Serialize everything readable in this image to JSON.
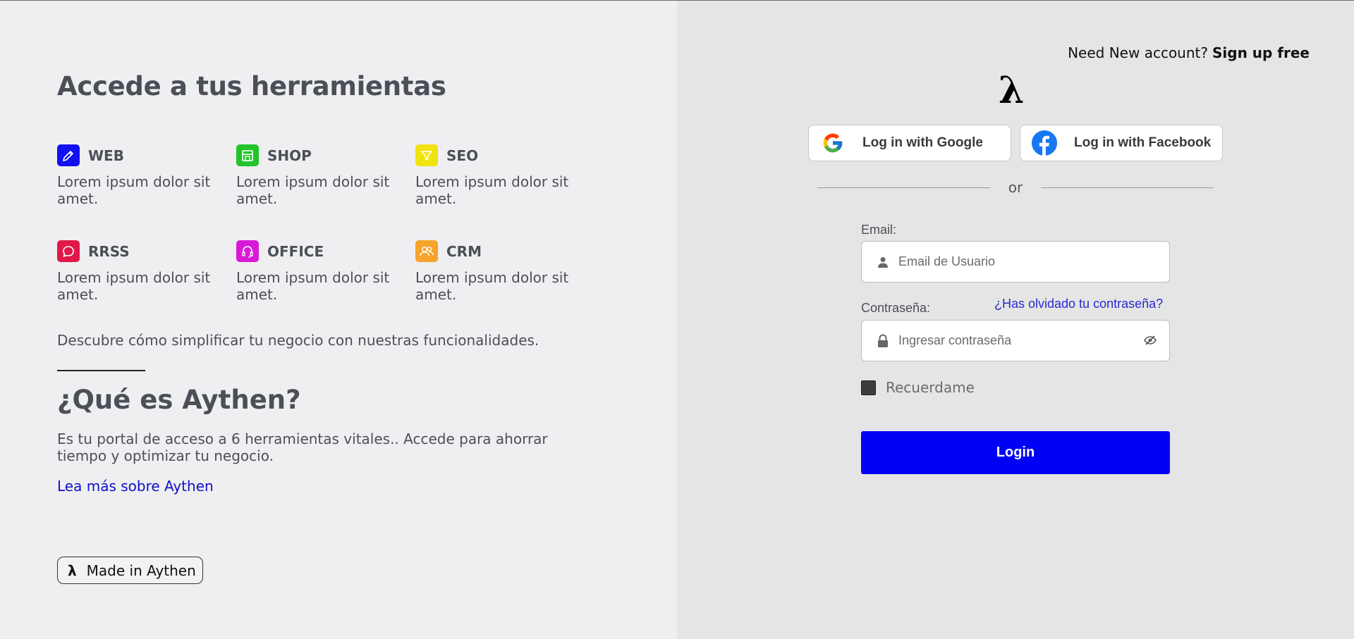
{
  "left": {
    "heading": "Accede a tus herramientas",
    "tools": [
      {
        "name": "WEB",
        "desc": "Lorem ipsum dolor sit amet.",
        "color": "#1010f0",
        "icon": "pencil-icon"
      },
      {
        "name": "SHOP",
        "desc": "Lorem ipsum dolor sit amet.",
        "color": "#22c42a",
        "icon": "store-icon"
      },
      {
        "name": "SEO",
        "desc": "Lorem ipsum dolor sit amet.",
        "color": "#f2e20f",
        "icon": "filter-icon"
      },
      {
        "name": "RRSS",
        "desc": "Lorem ipsum dolor sit amet.",
        "color": "#e0184a",
        "icon": "chat-bubble-icon"
      },
      {
        "name": "OFFICE",
        "desc": "Lorem ipsum dolor sit amet.",
        "color": "#d81ad8",
        "icon": "headset-icon"
      },
      {
        "name": "CRM",
        "desc": "Lorem ipsum dolor sit amet.",
        "color": "#f5a32a",
        "icon": "users-icon"
      }
    ],
    "discover": "Descubre cómo simplificar tu negocio con nuestras funcionalidades.",
    "what_title": "¿Qué es Aythen?",
    "what_desc": "Es tu portal de acceso a 6 herramientas vitales.. Accede para ahorrar tiempo y optimizar tu negocio.",
    "read_more": "Lea más sobre Aythen",
    "made_in": "Made in Aythen"
  },
  "right": {
    "signup_question": "Need New account?",
    "signup_link": "Sign up free",
    "logo": "λ",
    "google_label": "Log in with Google",
    "facebook_label": "Log in with Facebook",
    "or_text": "or",
    "email_label": "Email:",
    "email_placeholder": "Email de Usuario",
    "password_label": "Contraseña:",
    "forgot_link": "¿Has olvidado tu contraseña?",
    "password_placeholder": "Ingresar contraseña",
    "remember_label": "Recuerdame",
    "login_label": "Login",
    "accent_color": "#0000f5"
  }
}
